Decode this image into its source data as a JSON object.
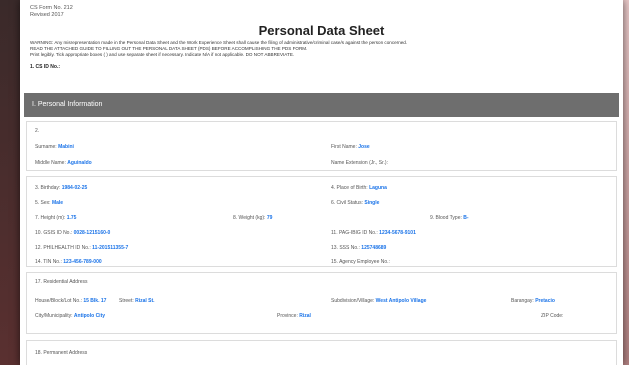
{
  "form": {
    "form_no": "CS Form No. 212",
    "revised": "Revised 2017",
    "title": "Personal Data Sheet",
    "warning": "WARNING: Any misrepresentation made in the Personal Data Sheet and the Work Experience Sheet shall cause the filing of administrative/criminal case/s against the person concerned.",
    "guide": "READ THE ATTACHED GUIDE TO FILLING OUT THE PERSONAL DATA SHEET (PDS) BEFORE ACCOMPLISHING THE PDS FORM.",
    "print_note": "Print legibly. Tick appropriate boxes ( ) and use separate sheet if necessary. Indicate N/A if not applicable. DO NOT ABBREVIATE.",
    "cs_id_label": "1. CS ID No.:"
  },
  "section": {
    "title": "I. Personal Information"
  },
  "name_block": {
    "number": "2.",
    "surname_label": "Surname:",
    "surname": "Mabini",
    "first_name_label": "First Name:",
    "first_name": "Jose",
    "middle_name_label": "Middle Name:",
    "middle_name": "Aguinaldo",
    "name_ext_label": "Name Extension (Jr., Sr.):",
    "name_ext": ""
  },
  "details": {
    "birthday_label": "3. Birthday:",
    "birthday": "1984-02-25",
    "birthplace_label": "4. Place of Birth:",
    "birthplace": "Laguna",
    "sex_label": "5. Sex:",
    "sex": "Male",
    "civil_status_label": "6. Civil Status:",
    "civil_status": "Single",
    "height_label": "7. Height (m):",
    "height": "1.75",
    "weight_label": "8. Weight (kg):",
    "weight": "79",
    "blood_type_label": "9. Blood Type:",
    "blood_type": "B-",
    "gsis_label": "10. GSIS ID No.:",
    "gsis": "0028-1215160-0",
    "pagibig_label": "11. PAG-IBIG ID No.:",
    "pagibig": "1234-5678-9101",
    "philhealth_label": "12. PHILHEALTH ID No.:",
    "philhealth": "11-201511355-7",
    "sss_label": "13. SSS No.:",
    "sss": "125748689",
    "tin_label": "14. TIN No.:",
    "tin": "123-456-789-000",
    "agency_label": "15. Agency Employee No.:",
    "agency": ""
  },
  "residential": {
    "header": "17. Residential Address",
    "house_label": "House/Block/Lot No.:",
    "house": "15 Blk. 17",
    "street_label": "Street:",
    "street": "Rizal St.",
    "subdivision_label": "Subdivision/Village:",
    "subdivision": "West Antipolo Village",
    "barangay_label": "Barangay:",
    "barangay": "Pretacio",
    "city_label": "City/Municipality:",
    "city": "Antipolo City",
    "province_label": "Province:",
    "province": "Rizal",
    "zip_label": "ZIP Code:",
    "zip": ""
  },
  "permanent": {
    "header": "18. Permanent Address"
  }
}
